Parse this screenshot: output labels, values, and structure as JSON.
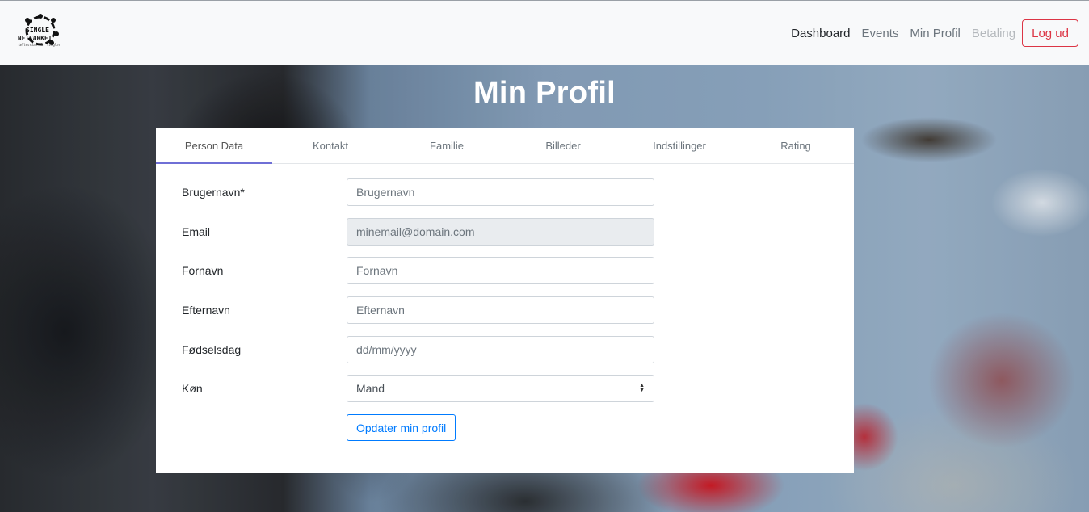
{
  "brand": {
    "logo_line1": "SINGLE",
    "logo_line2": "NETVÆRKET",
    "logo_line3": "fællesskab for singler"
  },
  "nav": {
    "items": [
      {
        "label": "Dashboard",
        "state": "active"
      },
      {
        "label": "Events",
        "state": "normal"
      },
      {
        "label": "Min Profil",
        "state": "normal"
      },
      {
        "label": "Betaling",
        "state": "disabled"
      }
    ],
    "logout_label": "Log ud"
  },
  "page": {
    "title": "Min Profil"
  },
  "tabs": [
    {
      "label": "Person Data",
      "active": true
    },
    {
      "label": "Kontakt",
      "active": false
    },
    {
      "label": "Familie",
      "active": false
    },
    {
      "label": "Billeder",
      "active": false
    },
    {
      "label": "Indstillinger",
      "active": false
    },
    {
      "label": "Rating",
      "active": false
    }
  ],
  "form": {
    "username": {
      "label": "Brugernavn*",
      "placeholder": "Brugernavn",
      "value": ""
    },
    "email": {
      "label": "Email",
      "value": "minemail@domain.com"
    },
    "firstname": {
      "label": "Fornavn",
      "placeholder": "Fornavn",
      "value": ""
    },
    "lastname": {
      "label": "Efternavn",
      "placeholder": "Efternavn",
      "value": ""
    },
    "birthday": {
      "label": "Fødselsdag",
      "placeholder": "dd/mm/yyyy",
      "value": ""
    },
    "gender": {
      "label": "Køn",
      "selected": "Mand"
    },
    "submit_label": "Opdater min profil"
  },
  "colors": {
    "danger": "#dc3545",
    "primary": "#007bff",
    "tab_indicator": "#6f6fd6"
  }
}
